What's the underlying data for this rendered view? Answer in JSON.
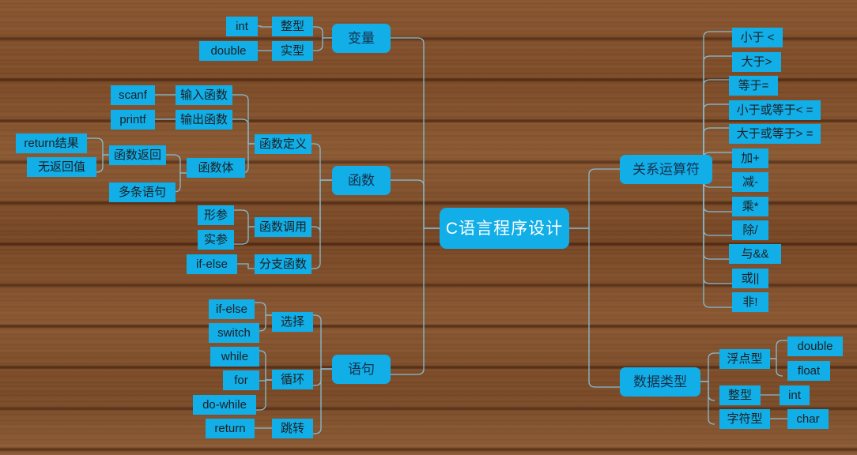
{
  "diagram": {
    "type": "mind-map",
    "root": {
      "label": "C语言程序设计"
    },
    "theme": {
      "node_fill": "#11aee8",
      "root_text": "#ffffff",
      "node_text": "#1f1f1f",
      "connector": "#86bdd2",
      "background": "#7b4a28"
    },
    "nodes": {
      "variable": "变量",
      "int_type": "整型",
      "int_kw": "int",
      "real_type": "实型",
      "double_kw": "double",
      "function": "函数",
      "func_def": "函数定义",
      "func_return": "函数返回",
      "return_result": "return结果",
      "no_return": "无返回值",
      "func_body": "函数体",
      "multi_stmt": "多条语句",
      "input_func": "输入函数",
      "scanf_kw": "scanf",
      "output_func": "输出函数",
      "printf_kw": "printf",
      "func_call": "函数调用",
      "formal_param": "形参",
      "actual_param": "实参",
      "branch_func": "分支函数",
      "if_else_func": "if-else",
      "statement": "语句",
      "select": "选择",
      "if_else_stmt": "if-else",
      "switch_kw": "switch",
      "loop": "循环",
      "while_kw": "while",
      "for_kw": "for",
      "do_while_kw": "do-while",
      "jump": "跳转",
      "return_kw": "return",
      "rel_operator": "关系运算符",
      "less_than": "小于 <",
      "greater_than": "大于>",
      "equal_to": "等于=",
      "less_equal": "小于或等于< =",
      "greater_equal": "大于或等于> =",
      "plus": "加+",
      "minus": "减-",
      "multiply": "乘*",
      "divide": "除/",
      "and_op": "与&&",
      "or_op": "或||",
      "not_op": "非!",
      "data_type": "数据类型",
      "float_type": "浮点型",
      "double_kw2": "double",
      "float_kw": "float",
      "integer_type": "整型",
      "int_kw2": "int",
      "char_type": "字符型",
      "char_kw": "char"
    }
  }
}
